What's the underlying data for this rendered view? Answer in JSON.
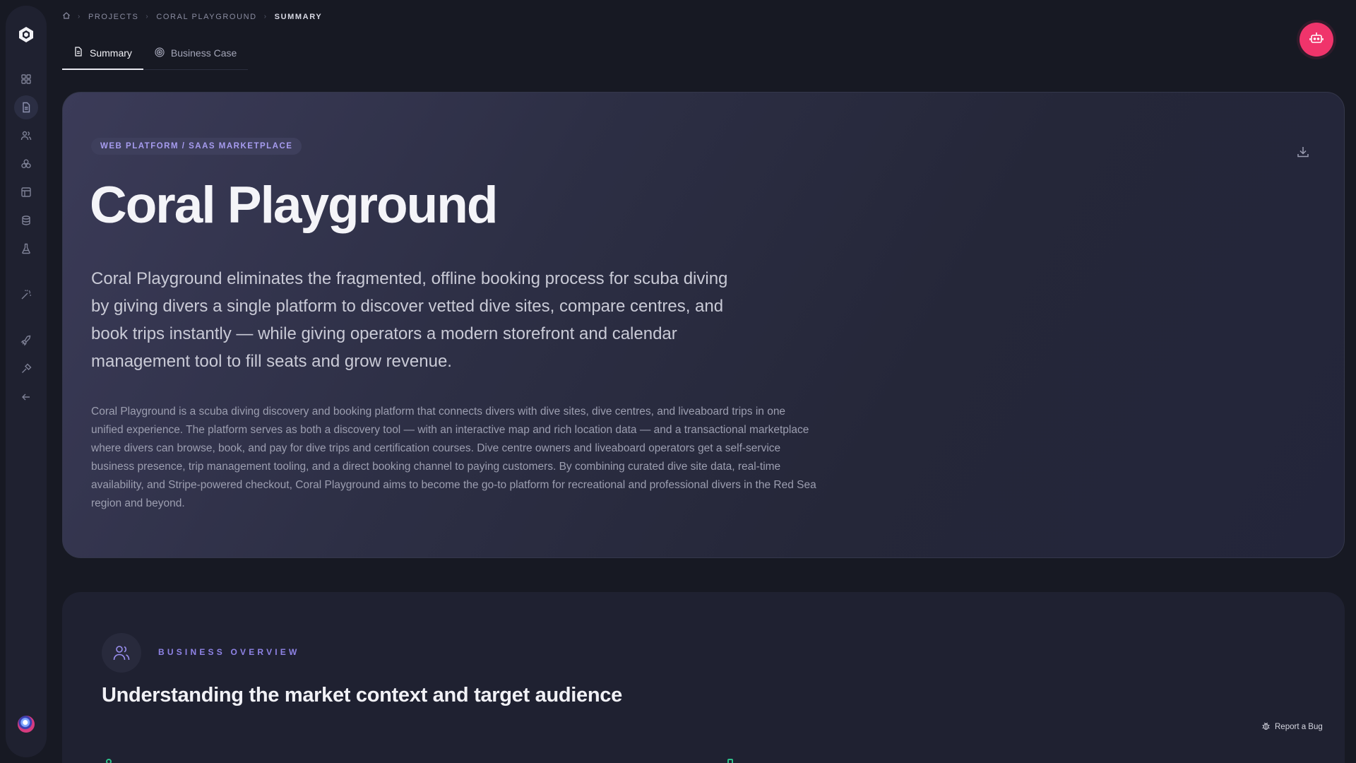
{
  "breadcrumb": {
    "items": [
      "PROJECTS",
      "CORAL PLAYGROUND"
    ],
    "current": "SUMMARY"
  },
  "tabs": [
    {
      "label": "Summary",
      "active": true,
      "icon": "document-icon"
    },
    {
      "label": "Business Case",
      "active": false,
      "icon": "target-icon"
    }
  ],
  "sidebar": {
    "items": [
      {
        "icon": "dashboard-icon",
        "active": false
      },
      {
        "icon": "document-icon",
        "active": true
      },
      {
        "icon": "users-icon",
        "active": false
      },
      {
        "icon": "modules-icon",
        "active": false
      },
      {
        "icon": "layout-icon",
        "active": false
      },
      {
        "icon": "database-icon",
        "active": false
      },
      {
        "icon": "flask-icon",
        "active": false
      },
      {
        "icon": "magic-wand-icon",
        "active": false
      },
      {
        "icon": "rocket-icon",
        "active": false
      },
      {
        "icon": "hammer-icon",
        "active": false
      },
      {
        "icon": "arrow-left-icon",
        "active": false
      }
    ]
  },
  "hero": {
    "badge": "WEB PLATFORM / SAAS MARKETPLACE",
    "title": "Coral Playground",
    "lead": "Coral Playground eliminates the fragmented, offline booking process for scuba diving by giving divers a single platform to discover vetted dive sites, compare centres, and book trips instantly — while giving operators a modern storefront and calendar management tool to fill seats and grow revenue.",
    "description": "Coral Playground is a scuba diving discovery and booking platform that connects divers with dive sites, dive centres, and liveaboard trips in one unified experience. The platform serves as both a discovery tool — with an interactive map and rich location data — and a transactional marketplace where divers can browse, book, and pay for dive trips and certification courses. Dive centre owners and liveaboard operators get a self-service business presence, trip management tooling, and a direct booking channel to paying customers. By combining curated dive site data, real-time availability, and Stripe-powered checkout, Coral Playground aims to become the go-to platform for recreational and professional divers in the Red Sea region and beyond."
  },
  "overview": {
    "label": "BUSINESS OVERVIEW",
    "title": "Understanding the market context and target audience"
  },
  "report_bug": {
    "label": "Report a Bug"
  },
  "colors": {
    "accent": "#f0346b",
    "badge_text": "#a79cf0",
    "label": "#8f83e6",
    "background": "#171923"
  }
}
